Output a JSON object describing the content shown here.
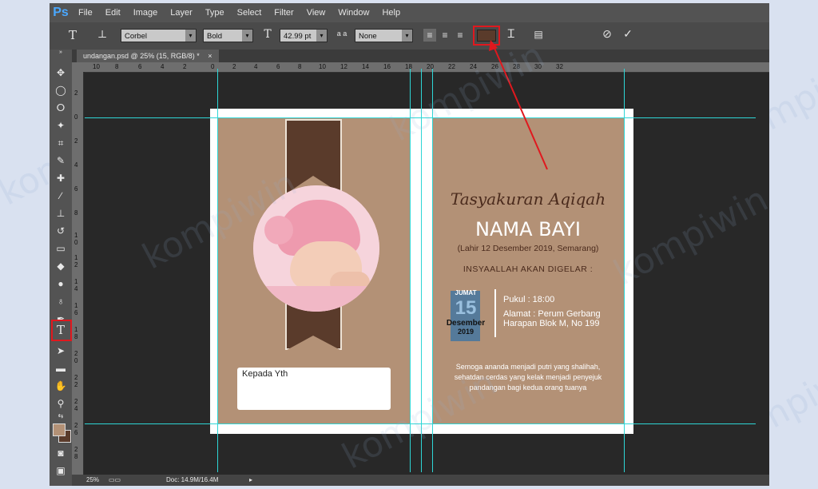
{
  "app": {
    "logo": "Ps"
  },
  "menu": [
    "File",
    "Edit",
    "Image",
    "Layer",
    "Type",
    "Select",
    "Filter",
    "View",
    "Window",
    "Help"
  ],
  "options": {
    "tool_glyph": "T",
    "font_family": "Corbel",
    "font_style": "Bold",
    "font_size": "42.99 pt",
    "aa_label": "a a",
    "antialias": "None",
    "text_color": "#5a3b2b"
  },
  "document_tab": {
    "label": "undangan.psd @ 25% (15, RGB/8) *",
    "close": "×"
  },
  "ruler_h": [
    "10",
    "8",
    "6",
    "4",
    "2",
    "0",
    "2",
    "4",
    "6",
    "8",
    "10",
    "12",
    "14",
    "16",
    "18",
    "20",
    "22",
    "24",
    "26",
    "28",
    "30",
    "32"
  ],
  "ruler_v": [
    "2",
    "0",
    "2",
    "4",
    "6",
    "8",
    "1 0",
    "1 2",
    "1 4",
    "1 6",
    "1 8",
    "2 0",
    "2 2",
    "2 4",
    "2 6",
    "2 8"
  ],
  "status": {
    "zoom": "25%",
    "doc": "Doc: 14.9M/16.4M"
  },
  "invitation": {
    "title_script": "Tasyakuran Aqiqah",
    "baby_name": "NAMA BAYI",
    "birth_info": "(Lahir 12 Desember 2019, Semarang)",
    "announce": "INSYAALLAH AKAN DIGELAR :",
    "day": "JUMAT",
    "date": "15",
    "month": "Desember",
    "year": "2019",
    "time": "Pukul : 18:00",
    "address_line1": "Alamat : Perum Gerbang",
    "address_line2": "Harapan Blok M, No 199",
    "prayer_line1": "Semoga ananda menjadi putri yang shalihah,",
    "prayer_line2": "sehatdan cerdas yang kelak menjadi penyejuk",
    "prayer_line3": "pandangan bagi kedua orang tuanya",
    "to_label": "Kepada Yth"
  },
  "watermark": "kompiwin",
  "colors": {
    "accent_red": "#e0181e",
    "guide": "#2ed6d6",
    "panel": "#b39176",
    "ribbon": "#5a3b2b"
  }
}
